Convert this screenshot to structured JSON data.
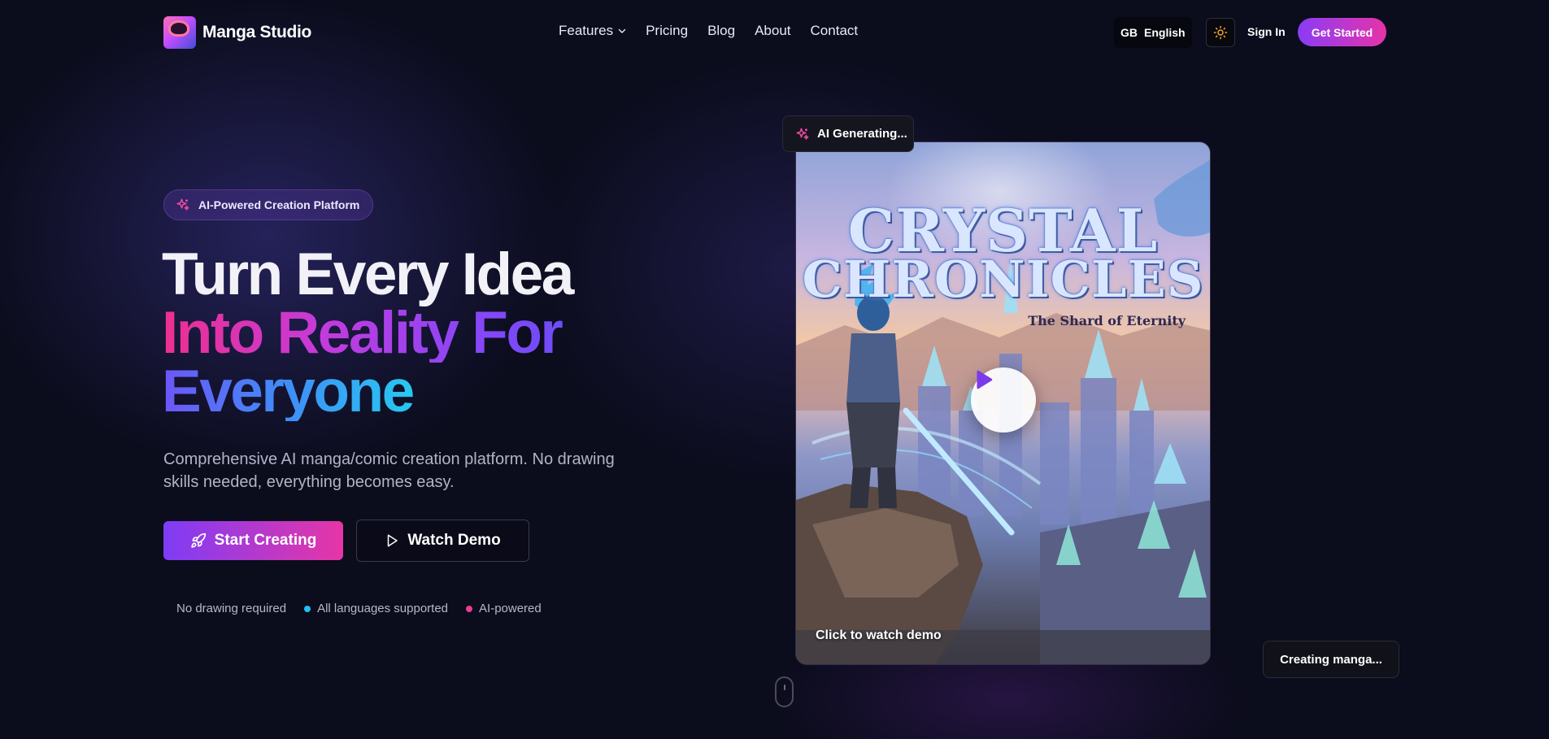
{
  "nav": {
    "logo_text": "Manga Studio",
    "links": [
      {
        "label": "Features",
        "has_dropdown": true
      },
      {
        "label": "Pricing"
      },
      {
        "label": "Blog"
      },
      {
        "label": "About"
      },
      {
        "label": "Contact"
      }
    ],
    "language": {
      "flag": "GB",
      "label": "English"
    },
    "theme_icon": "sun-icon",
    "sign_in": "Sign In",
    "get_started": "Get Started"
  },
  "hero": {
    "badge": "AI-Powered Creation Platform",
    "headline_line1": "Turn Every Idea",
    "headline_line2": "Into Reality For",
    "headline_line3": "Everyone",
    "subtext": "Comprehensive AI manga/comic creation platform. No drawing skills needed, everything becomes easy.",
    "start_button": "Start Creating",
    "demo_button": "Watch Demo",
    "features": [
      {
        "label": "No drawing required",
        "dot_color": null
      },
      {
        "label": "All languages supported",
        "dot_color": "#22c0f0"
      },
      {
        "label": "AI-powered",
        "dot_color": "#ee3a96"
      }
    ]
  },
  "preview": {
    "status_badge": "AI Generating...",
    "cover_title_line1": "CRYSTAL",
    "cover_title_line2": "CHRONICLES",
    "cover_subtitle": "The Shard of Eternity",
    "caption": "Click to watch demo",
    "floating_status": "Creating manga..."
  },
  "colors": {
    "accent_purple": "#8a3cf7",
    "accent_pink": "#e733a8",
    "background": "#0b0c1c"
  }
}
